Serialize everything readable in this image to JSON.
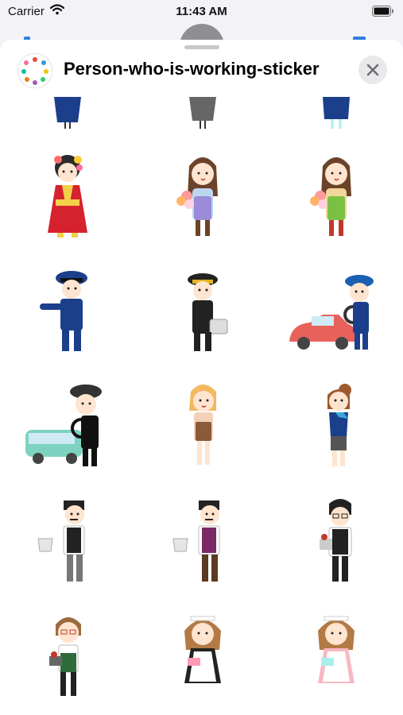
{
  "status_bar": {
    "carrier": "Carrier",
    "time": "11:43 AM"
  },
  "sheet": {
    "title": "Person-who-is-working-sticker",
    "icon": "sticker-pack-icon",
    "close_icon": "close-icon"
  },
  "stickers": [
    {
      "name": "bride-in-red-kimono"
    },
    {
      "name": "florist-purple-apron"
    },
    {
      "name": "florist-green-apron"
    },
    {
      "name": "police-officer"
    },
    {
      "name": "airline-pilot"
    },
    {
      "name": "taxi-driver"
    },
    {
      "name": "bus-driver"
    },
    {
      "name": "waitress-blonde"
    },
    {
      "name": "flight-attendant"
    },
    {
      "name": "waiter-grey-vest"
    },
    {
      "name": "waiter-purple-vest"
    },
    {
      "name": "waiter-glasses"
    },
    {
      "name": "barista-red-glasses"
    },
    {
      "name": "maid-black-dress"
    },
    {
      "name": "maid-pink-dress"
    }
  ],
  "colors": {
    "accent": "#2f7de1",
    "sheet_bg": "#ffffff",
    "page_bg": "#f2f2f7",
    "close_bg": "#e9e9eb"
  }
}
